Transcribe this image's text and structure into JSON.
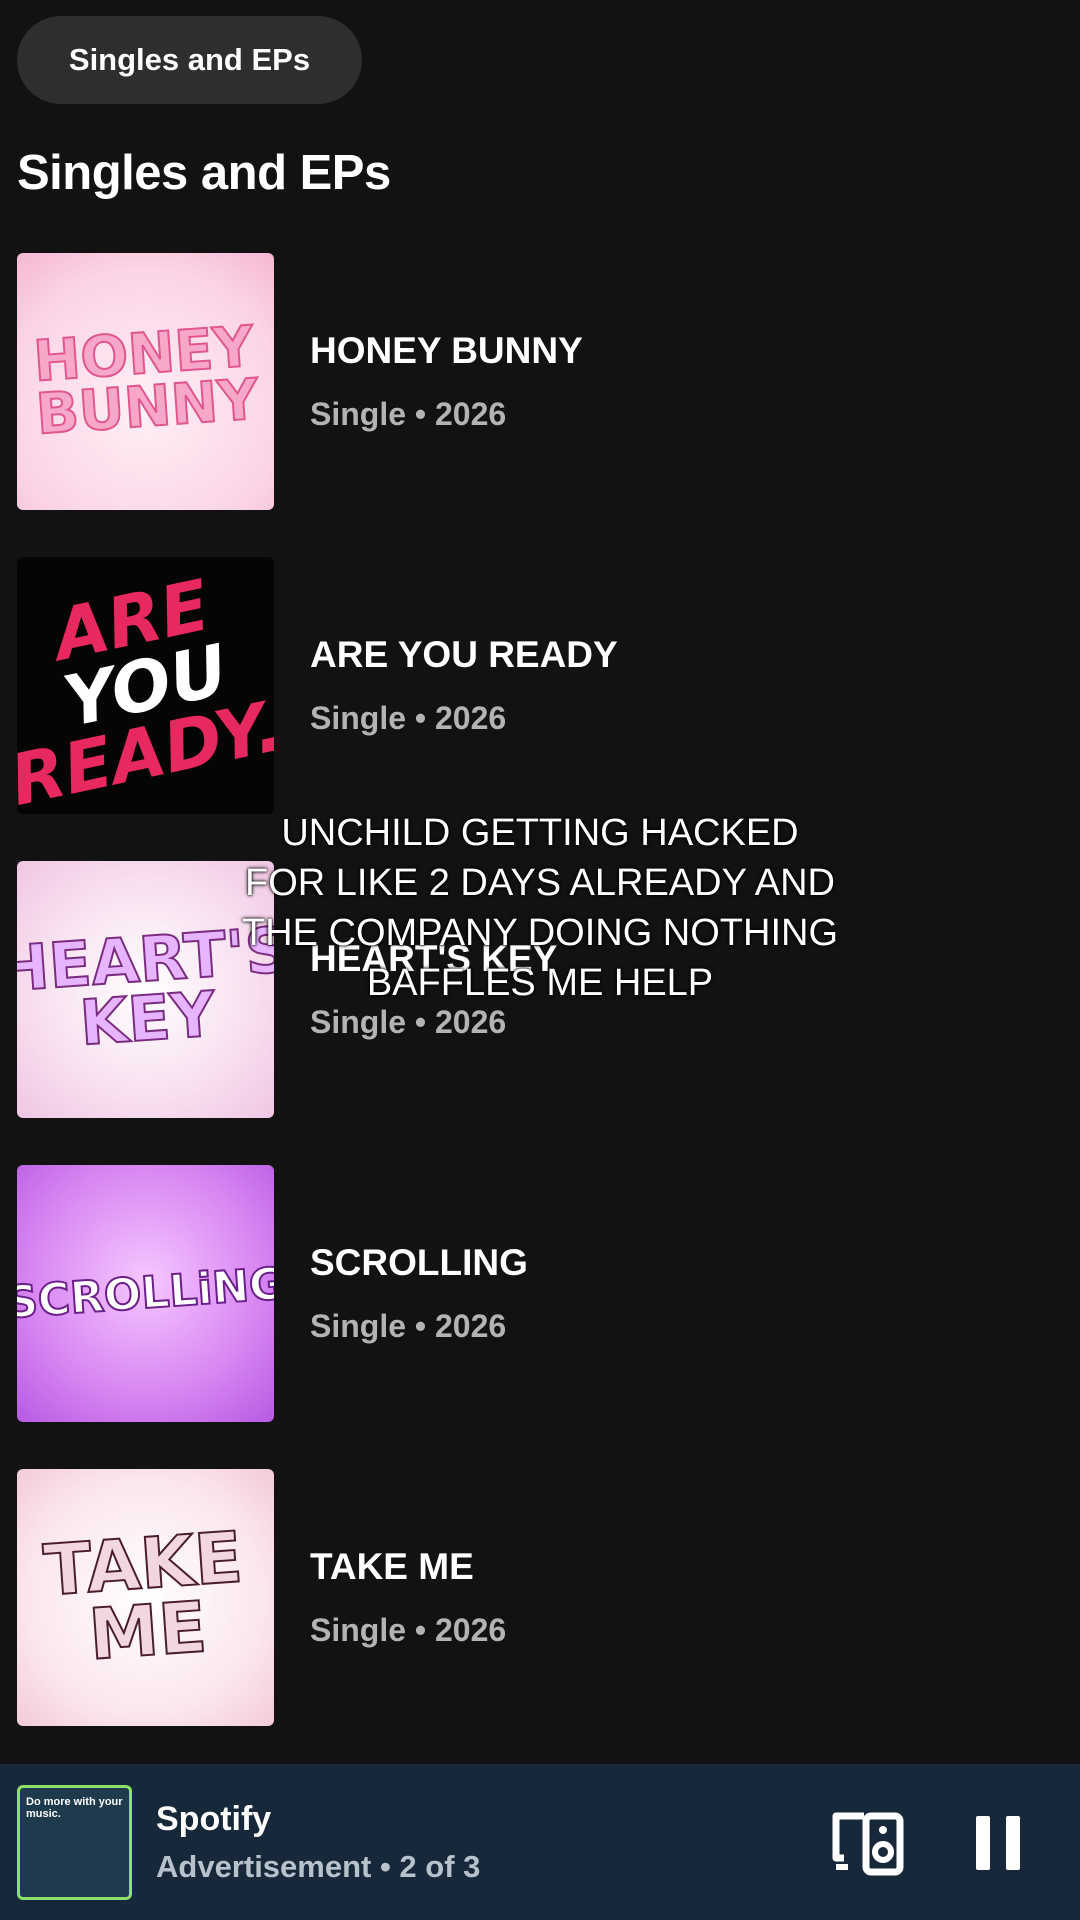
{
  "filter_chip": {
    "label": "Singles and EPs"
  },
  "section": {
    "title": "Singles and EPs"
  },
  "releases": [
    {
      "title": "HONEY BUNNY",
      "subtitle": "Single • 2026",
      "art_text": "HONEY BUNNY"
    },
    {
      "title": "ARE YOU READY",
      "subtitle": "Single • 2026",
      "art_text": "ARE YOU READY.."
    },
    {
      "title": "HEART'S KEY",
      "subtitle": "Single • 2026",
      "art_text": "HEART'S KEY"
    },
    {
      "title": "SCROLLING",
      "subtitle": "Single • 2026",
      "art_text": "SCROLLiNG"
    },
    {
      "title": "TAKE ME",
      "subtitle": "Single • 2026",
      "art_text": "TAKE ME"
    }
  ],
  "overlay_caption": "UNCHILD GETTING HACKED FOR LIKE 2 DAYS ALREADY AND THE COMPANY DOING NOTHING BAFFLES ME HELP",
  "now_playing": {
    "thumb_text": "Do more with your music.",
    "title": "Spotify",
    "subtitle": "Advertisement • 2 of 3",
    "device_icon": "connect-device-icon",
    "pause_icon": "pause-icon"
  },
  "colors": {
    "background": "#121212",
    "chip": "#2e2e2e",
    "secondary_text": "#b3b3b3",
    "player_bar": "#17283a",
    "ready_pink": "#e8295f"
  }
}
